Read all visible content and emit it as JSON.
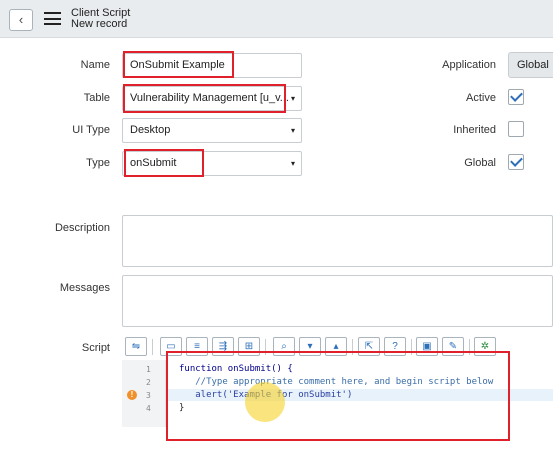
{
  "header": {
    "back_glyph": "‹",
    "title": "Client Script",
    "subtitle": "New record"
  },
  "form": {
    "name": {
      "label": "Name",
      "value": "OnSubmit Example"
    },
    "table": {
      "label": "Table",
      "value": "Vulnerability Management [u_v..."
    },
    "ui_type": {
      "label": "UI Type",
      "value": "Desktop"
    },
    "type": {
      "label": "Type",
      "value": "onSubmit"
    },
    "description": {
      "label": "Description",
      "value": ""
    },
    "messages": {
      "label": "Messages",
      "value": ""
    },
    "script": {
      "label": "Script"
    }
  },
  "right_panel": {
    "application": {
      "label": "Application",
      "value": "Global"
    },
    "active": {
      "label": "Active",
      "checked": true
    },
    "inherited": {
      "label": "Inherited",
      "checked": false
    },
    "global": {
      "label": "Global",
      "checked": true
    }
  },
  "toolbar_icons": [
    "format-code-icon",
    "comment-icon",
    "list-icon",
    "toggle-comment-icon",
    "toggle-format-icon",
    "search-icon",
    "find-next-icon",
    "find-prev-icon",
    "fullscreen-icon",
    "help-icon",
    "save-icon",
    "script-debugger-icon",
    "syntax-check-icon"
  ],
  "editor": {
    "line_numbers": [
      "1",
      "2",
      "3",
      "4"
    ],
    "lines": [
      "function onSubmit() {",
      "   //Type appropriate comment here, and begin script below",
      "   alert('Example for onSubmit')",
      "}"
    ]
  },
  "dropdown_glyph": "▾"
}
